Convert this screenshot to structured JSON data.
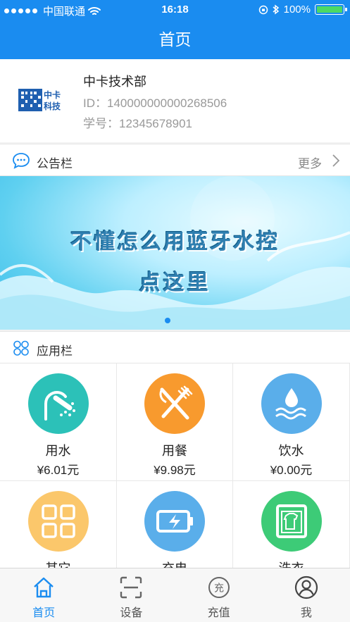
{
  "status_bar": {
    "carrier": "中国联通",
    "time": "16:18",
    "battery": "100%",
    "battery_level": 1.0
  },
  "nav": {
    "title": "首页"
  },
  "profile": {
    "name": "中卡技术部",
    "id": "ID：140000000000268506",
    "student_no": "学号：12345678901",
    "logo_text_top": "中卡",
    "logo_text_bottom": "科技"
  },
  "notice": {
    "title": "公告栏",
    "more": "更多"
  },
  "banner": {
    "line1": "不懂怎么用蓝牙水控",
    "line2": "点这里",
    "active_index": 0
  },
  "apps": {
    "title": "应用栏",
    "items": [
      {
        "label": "用水",
        "value": "¥6.01元",
        "icon": "shower-icon",
        "color": "#2cc1b8"
      },
      {
        "label": "用餐",
        "value": "¥9.98元",
        "icon": "utensils-icon",
        "color": "#f89a2e"
      },
      {
        "label": "饮水",
        "value": "¥0.00元",
        "icon": "water-drop-icon",
        "color": "#5aaeea"
      },
      {
        "label": "其它",
        "value": "",
        "icon": "grid-icon",
        "color": "#fbc76b"
      },
      {
        "label": "充电",
        "value": "",
        "icon": "battery-charge-icon",
        "color": "#5aaeea"
      },
      {
        "label": "洗衣",
        "value": "",
        "icon": "washer-icon",
        "color": "#3dcb77"
      }
    ]
  },
  "tabs": [
    {
      "label": "首页",
      "icon": "home-icon",
      "active": true
    },
    {
      "label": "设备",
      "icon": "scan-icon",
      "active": false
    },
    {
      "label": "充值",
      "icon": "recharge-icon",
      "active": false,
      "icon_text": "充"
    },
    {
      "label": "我",
      "icon": "user-icon",
      "active": false
    }
  ],
  "colors": {
    "primary": "#1a8cf0"
  }
}
